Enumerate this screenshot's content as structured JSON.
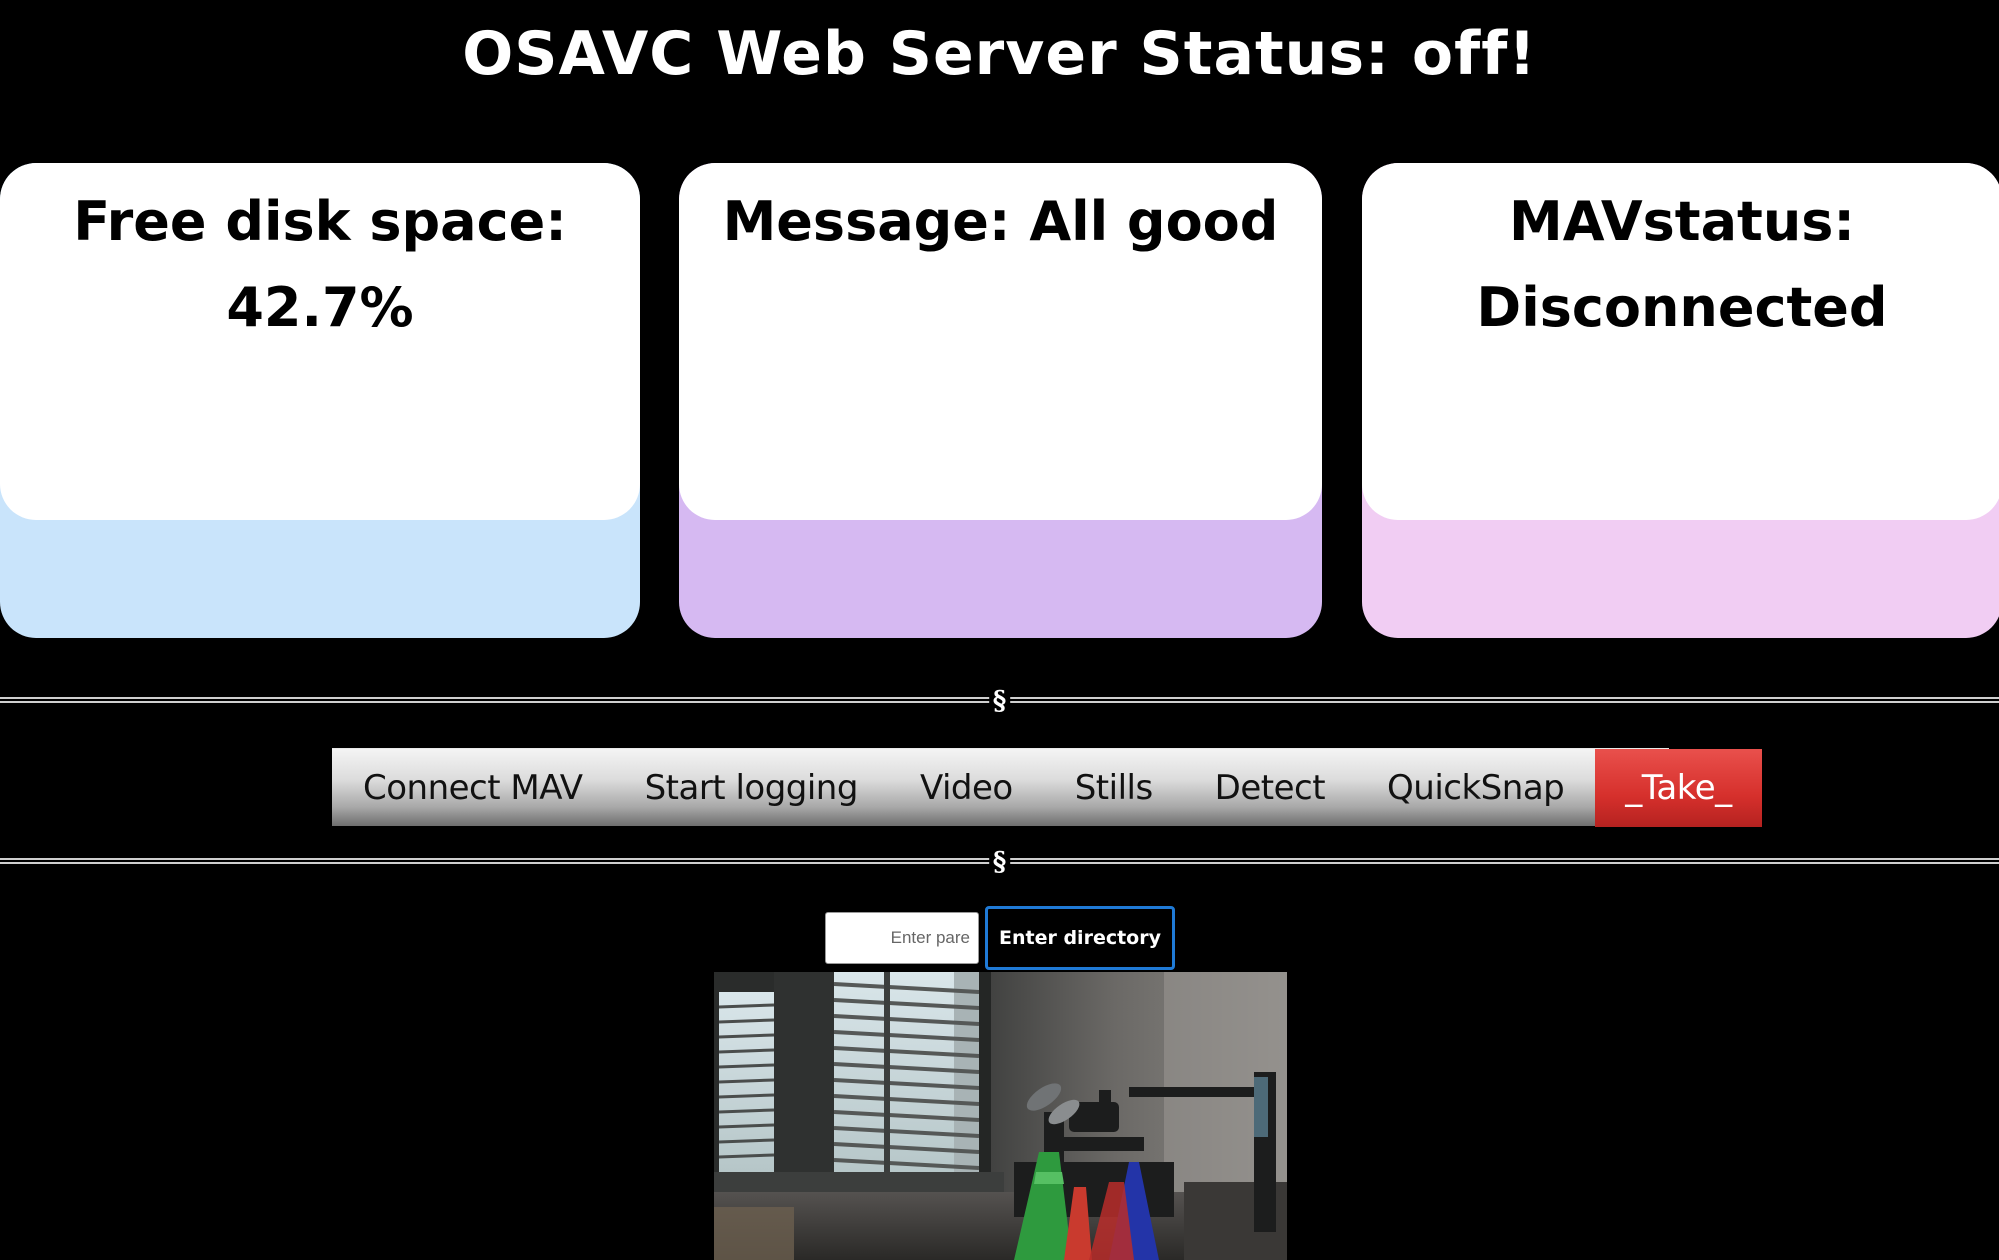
{
  "header": {
    "title": "OSAVC Web Server Status: off!"
  },
  "cards": {
    "disk": {
      "line1": "Free disk space:",
      "line2": "42.7%",
      "accent_color": "#c9e4fb"
    },
    "message": {
      "line1": "Message: All good",
      "accent_color": "#d6b9f2"
    },
    "mav": {
      "line1": "MAVstatus:",
      "line2": "Disconnected",
      "accent_color": "#f1cdf3"
    }
  },
  "divider": {
    "mark": "§"
  },
  "menu": {
    "items": [
      "Connect MAV",
      "Start logging",
      "Video",
      "Stills",
      "Detect",
      "QuickSnap",
      "_Take_"
    ],
    "take_color": "#d6302c"
  },
  "directory": {
    "placeholder": "Enter pare",
    "button_label": "Enter directory"
  },
  "camera": {
    "description_icon": "camera-feed-image"
  }
}
